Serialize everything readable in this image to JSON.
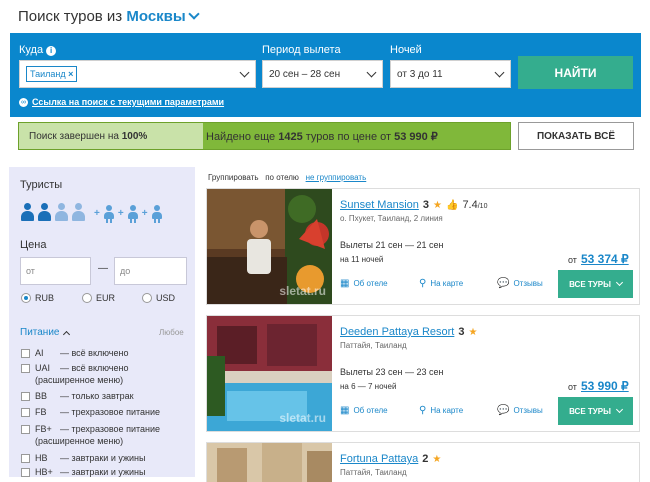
{
  "header": {
    "title_prefix": "Поиск туров из",
    "city": "Москвы"
  },
  "search": {
    "where_label": "Куда",
    "where_tag": "Таиланд",
    "period_label": "Период вылета",
    "period_value": "20 сен – 28 сен",
    "nights_label": "Ночей",
    "nights_value": "от 3 до 11",
    "find_button": "НАЙТИ",
    "link_text": "Ссылка на поиск с текущими параметрами"
  },
  "progress": {
    "percent": 100,
    "status_prefix": "Поиск завершен на",
    "status_value": "100%",
    "found_prefix": "Найдено еще",
    "found_count": "1425",
    "found_mid": "туров по цене от",
    "found_price": "53 990 ₽"
  },
  "show_all_button": "ПОКАЗАТЬ ВСЁ",
  "sidebar": {
    "tourists_label": "Туристы",
    "price_label": "Цена",
    "price_from_placeholder": "от",
    "price_to_placeholder": "до",
    "dash": "—",
    "currencies": [
      "RUB",
      "EUR",
      "USD"
    ],
    "currency_selected": "RUB",
    "meal_label": "Питание",
    "meal_any": "Любое",
    "meals": [
      {
        "code": "AI",
        "desc": "— всё включено"
      },
      {
        "code": "UAI",
        "desc": "— всё включено",
        "desc2": "(расширенное меню)"
      },
      {
        "code": "BB",
        "desc": "— только завтрак"
      },
      {
        "code": "FB",
        "desc": "— трехразовое питание"
      },
      {
        "code": "FB+",
        "desc": "— трехразовое питание",
        "desc2": "(расширенное меню)"
      },
      {
        "code": "HB",
        "desc": "— завтраки и ужины"
      },
      {
        "code": "HB+",
        "desc": "— завтраки и ужины"
      }
    ]
  },
  "grouping": {
    "label": "Группировать",
    "by_hotel": "по отелю",
    "not_grouped": "не группировать"
  },
  "hotels": [
    {
      "name": "Sunset Mansion",
      "stars": "3",
      "rating": "7.4",
      "rating_max": "/10",
      "location": "о. Пхукет, Таиланд, 2 линия",
      "dates": "Вылеты 21 сен — 21 сен",
      "nights": "на 11 ночей",
      "price_from": "от",
      "price": "53 374 ₽",
      "about": "Об отеле",
      "map": "На карте",
      "reviews": "Отзывы",
      "button": "ВСЕ ТУРЫ",
      "watermark": "sletat.ru"
    },
    {
      "name": "Deeden Pattaya Resort",
      "stars": "3",
      "location": "Паттайя, Таиланд",
      "dates": "Вылеты 23 сен — 23 сен",
      "nights": "на 6 — 7 ночей",
      "price_from": "от",
      "price": "53 990 ₽",
      "about": "Об отеле",
      "map": "На карте",
      "reviews": "Отзывы",
      "button": "ВСЕ ТУРЫ",
      "watermark": "sletat.ru"
    },
    {
      "name": "Fortuna Pattaya",
      "stars": "2",
      "location": "Паттайя, Таиланд"
    }
  ],
  "colors": {
    "brand_blue": "#0a87cd",
    "accent_green": "#34ad8e",
    "progress_green": "#80b83a",
    "link_blue": "#1a87c9"
  }
}
